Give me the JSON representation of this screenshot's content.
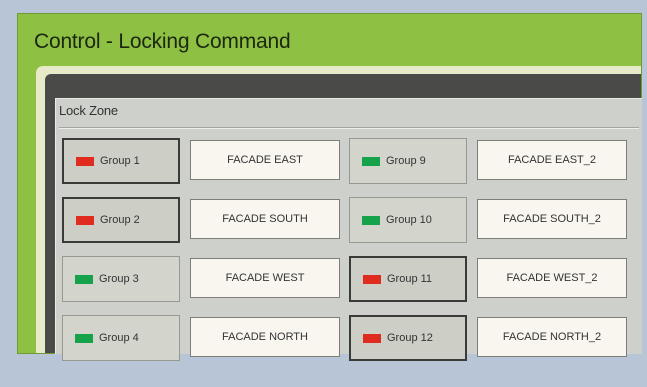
{
  "window": {
    "title": "Control - Locking Command"
  },
  "panel": {
    "label": "Lock Zone"
  },
  "colors": {
    "locked": "#e02b1f",
    "unlocked": "#16a24b"
  },
  "groups": [
    {
      "label": "Group 1",
      "target": "FACADE EAST",
      "status": "locked"
    },
    {
      "label": "Group 2",
      "target": "FACADE SOUTH",
      "status": "locked"
    },
    {
      "label": "Group 3",
      "target": "FACADE WEST",
      "status": "unlocked"
    },
    {
      "label": "Group 4",
      "target": "FACADE NORTH",
      "status": "unlocked"
    },
    {
      "label": "Group 9",
      "target": "FACADE EAST_2",
      "status": "unlocked"
    },
    {
      "label": "Group 10",
      "target": "FACADE SOUTH_2",
      "status": "unlocked"
    },
    {
      "label": "Group 11",
      "target": "FACADE WEST_2",
      "status": "locked"
    },
    {
      "label": "Group 12",
      "target": "FACADE NORTH_2",
      "status": "locked"
    }
  ]
}
